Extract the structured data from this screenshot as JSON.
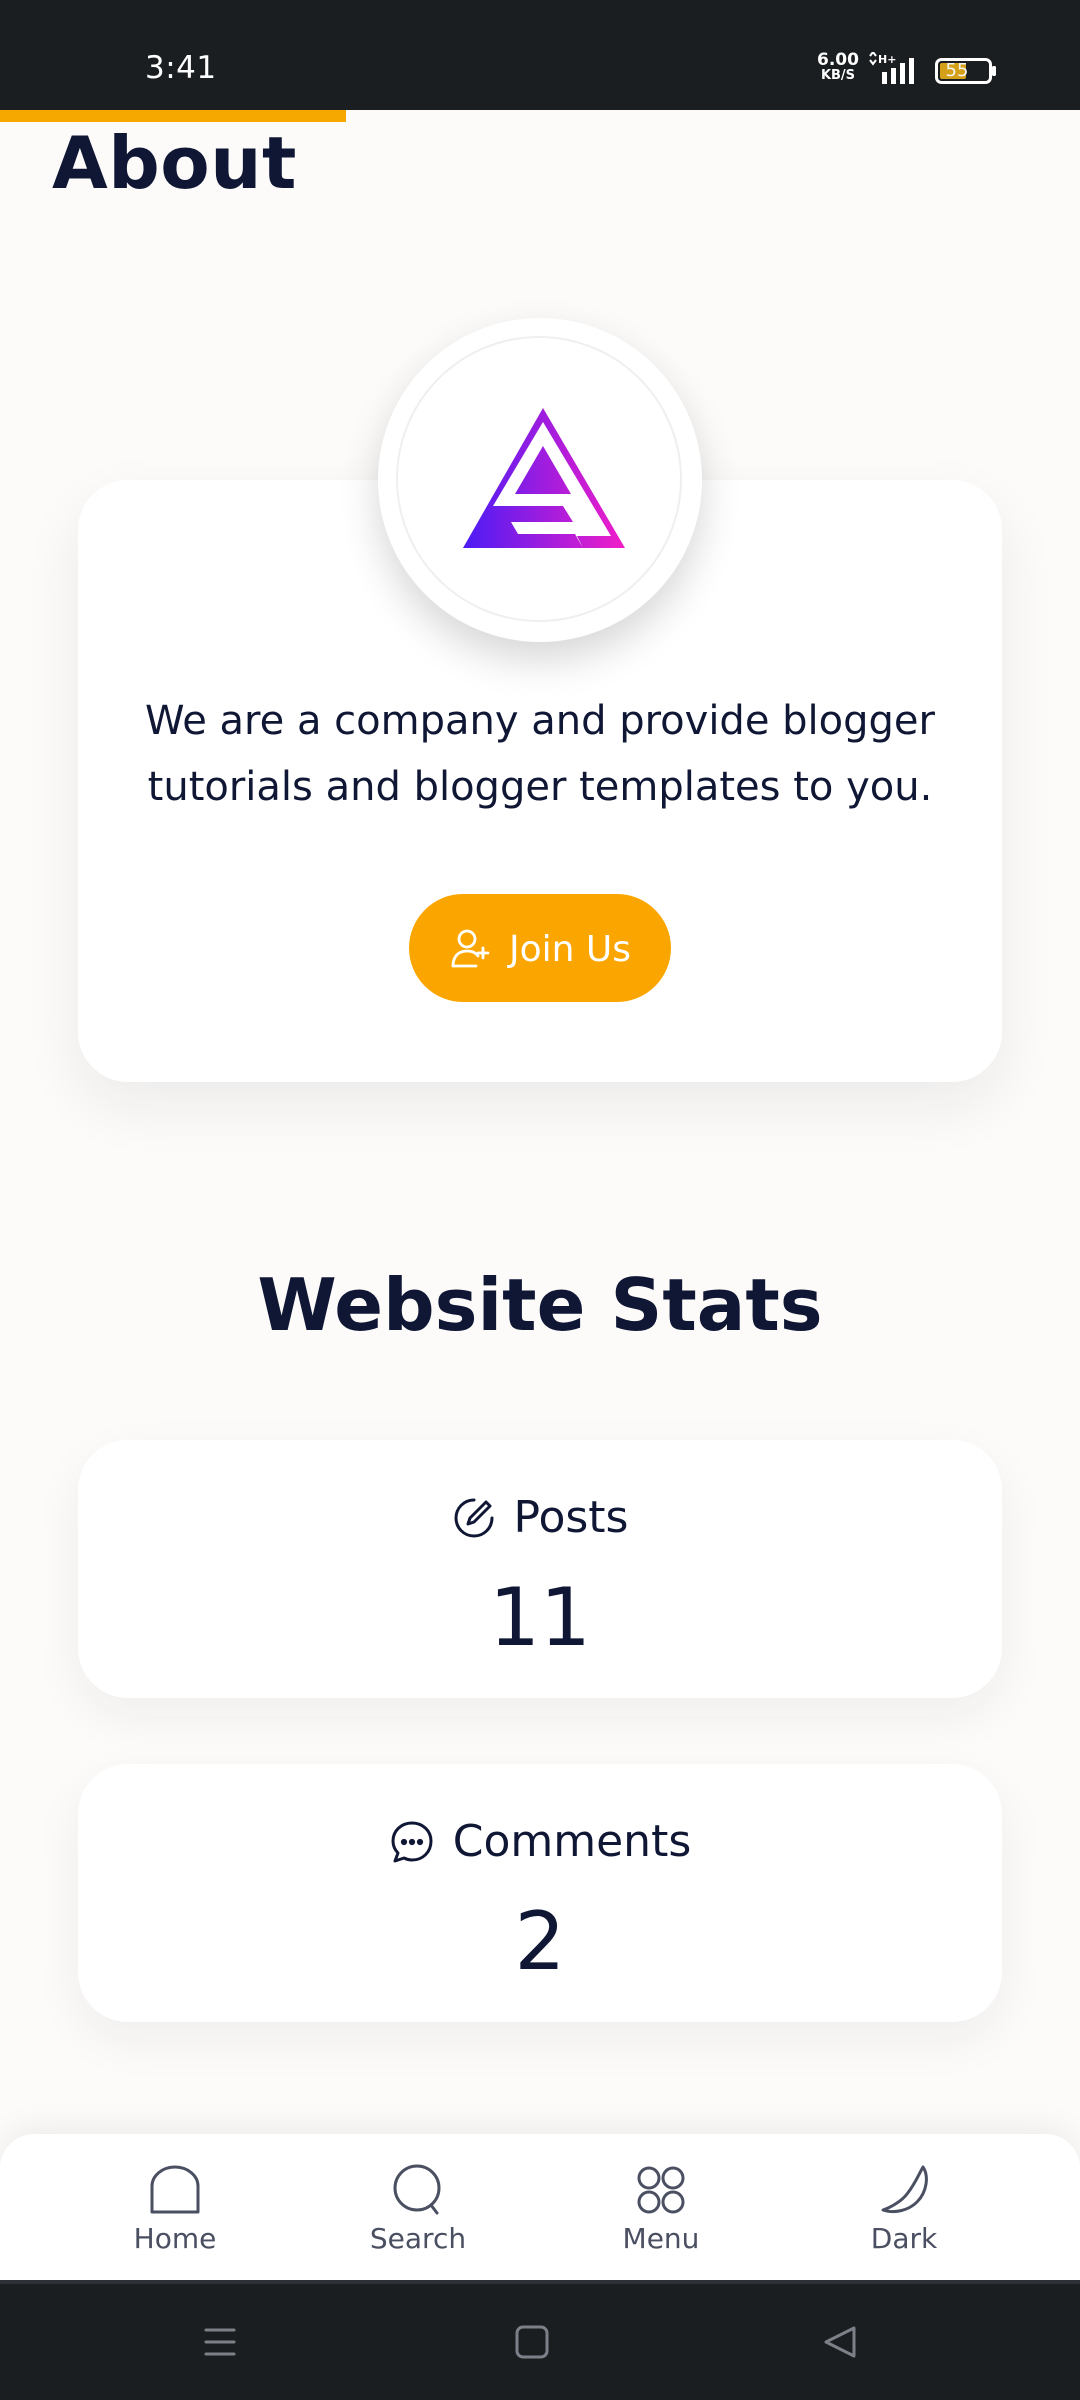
{
  "status_bar": {
    "time": "3:41",
    "network_speed": "6.00",
    "network_unit": "KB/S",
    "battery": "55"
  },
  "page": {
    "title": "About",
    "reading_progress_percent": 32
  },
  "about": {
    "description": "We are a company and provide blogger tutorials and blogger templates to you.",
    "join_button": {
      "label": "Join Us",
      "icon": "user-plus-icon"
    }
  },
  "stats": {
    "title": "Website Stats",
    "items": [
      {
        "label": "Posts",
        "value": "11",
        "icon": "edit-icon"
      },
      {
        "label": "Comments",
        "value": "2",
        "icon": "comment-icon"
      }
    ]
  },
  "bottom_nav": {
    "items": [
      {
        "label": "Home",
        "icon": "home-icon"
      },
      {
        "label": "Search",
        "icon": "search-icon"
      },
      {
        "label": "Menu",
        "icon": "menu-grid-icon"
      },
      {
        "label": "Dark",
        "icon": "moon-icon"
      }
    ]
  },
  "colors": {
    "accent": "#fba600",
    "text": "#0f1735",
    "background": "#fdfbf9",
    "logo_gradient_start": "#4b1cf5",
    "logo_gradient_end": "#f21ec8"
  }
}
